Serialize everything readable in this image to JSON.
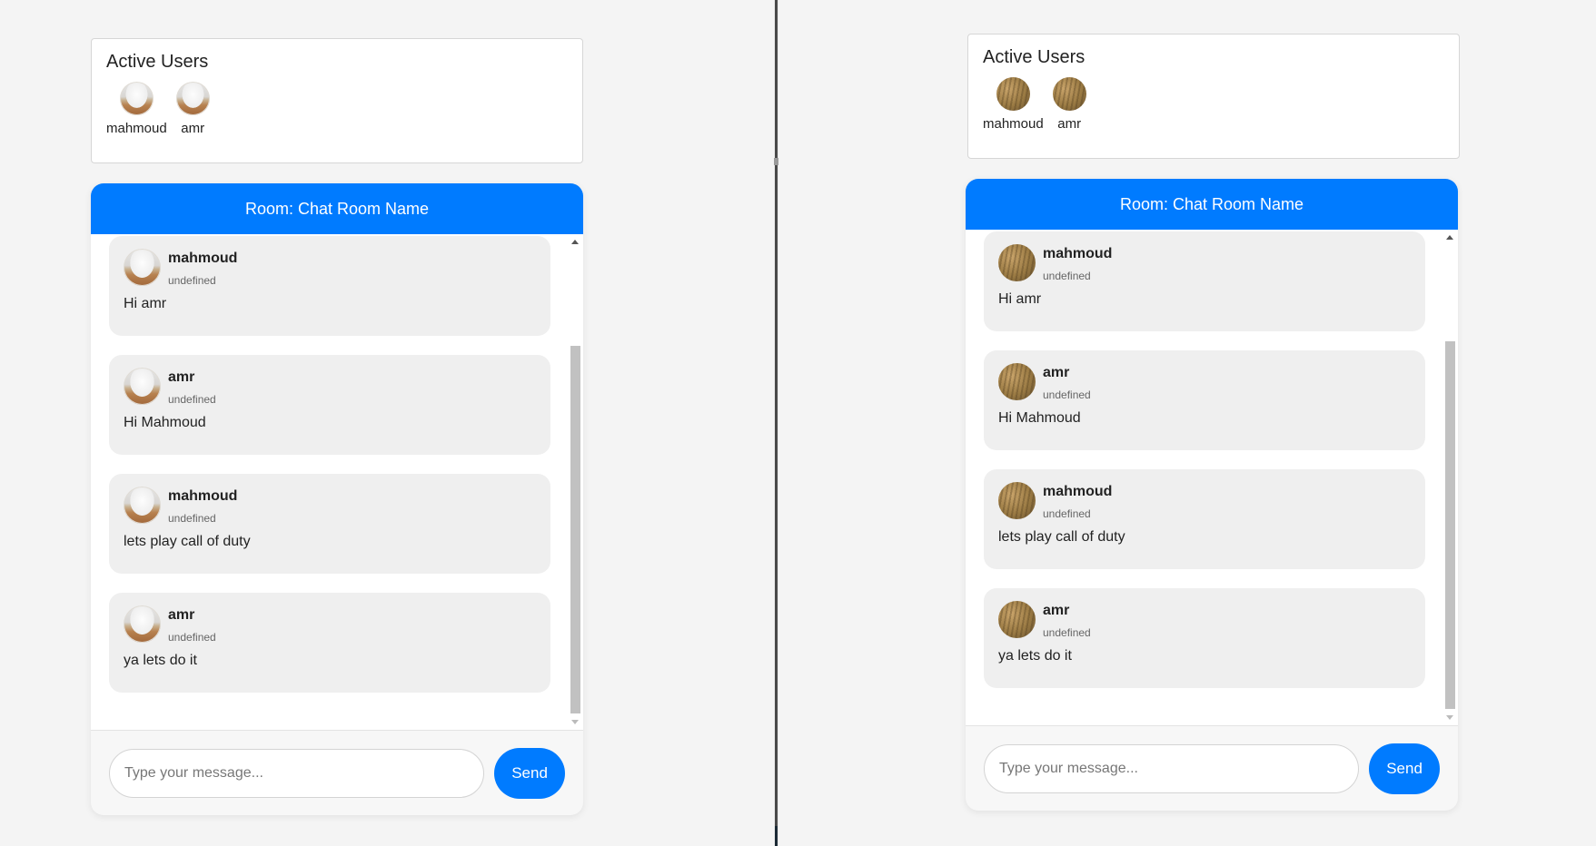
{
  "colors": {
    "accent": "#007bff",
    "bubble": "#efefef"
  },
  "left": {
    "active_users": {
      "title": "Active Users",
      "users": [
        {
          "name": "mahmoud",
          "avatar": "landscape-photo-avatar"
        },
        {
          "name": "amr",
          "avatar": "landscape-photo-avatar"
        }
      ]
    },
    "chat": {
      "header": "Room: Chat Room Name",
      "messages": [
        {
          "author": "mahmoud",
          "time": "undefined",
          "text": "Hi amr"
        },
        {
          "author": "amr",
          "time": "undefined",
          "text": "Hi Mahmoud"
        },
        {
          "author": "mahmoud",
          "time": "undefined",
          "text": "lets play call of duty"
        },
        {
          "author": "amr",
          "time": "undefined",
          "text": "ya lets do it"
        }
      ],
      "input": {
        "placeholder": "Type your message...",
        "value": ""
      },
      "send_label": "Send"
    }
  },
  "right": {
    "active_users": {
      "title": "Active Users",
      "users": [
        {
          "name": "mahmoud",
          "avatar": "wheat-photo-avatar"
        },
        {
          "name": "amr",
          "avatar": "wheat-photo-avatar"
        }
      ]
    },
    "chat": {
      "header": "Room: Chat Room Name",
      "messages": [
        {
          "author": "mahmoud",
          "time": "undefined",
          "text": "Hi amr"
        },
        {
          "author": "amr",
          "time": "undefined",
          "text": "Hi Mahmoud"
        },
        {
          "author": "mahmoud",
          "time": "undefined",
          "text": "lets play call of duty"
        },
        {
          "author": "amr",
          "time": "undefined",
          "text": "ya lets do it"
        }
      ],
      "input": {
        "placeholder": "Type your message...",
        "value": ""
      },
      "send_label": "Send"
    }
  }
}
